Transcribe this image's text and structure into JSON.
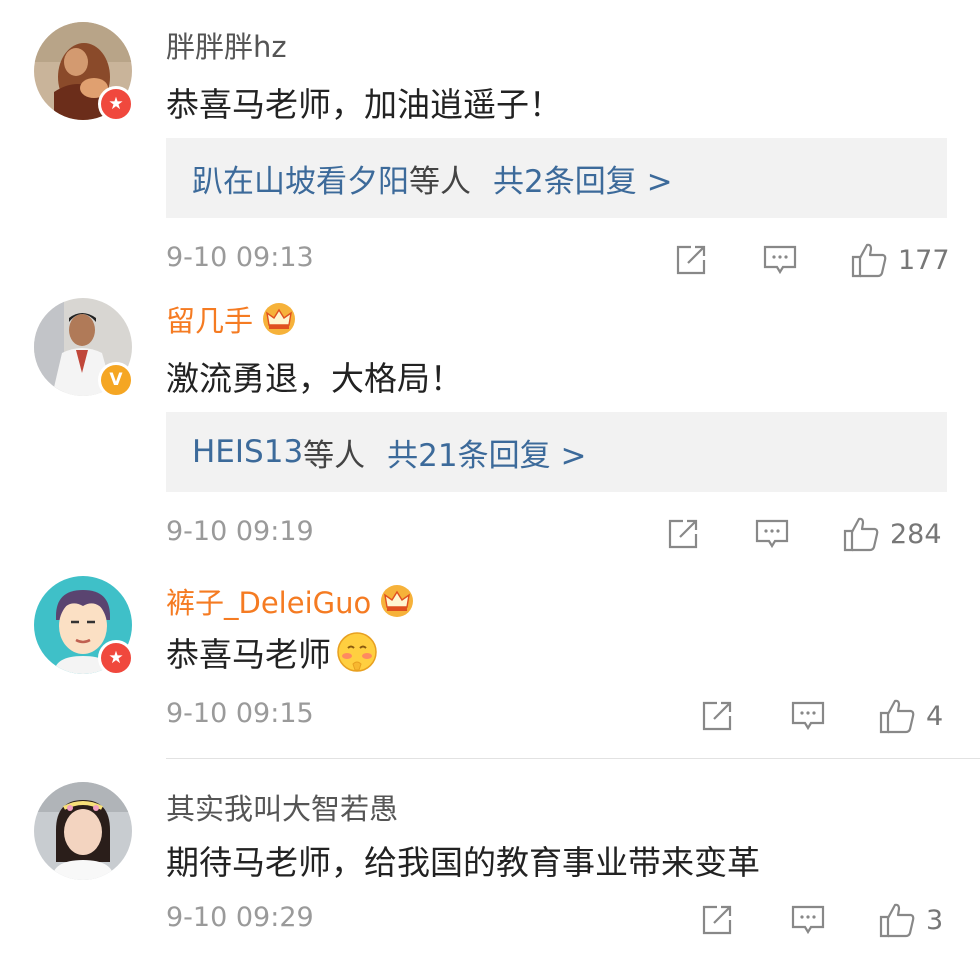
{
  "comments": [
    {
      "username": "胖胖胖hz",
      "vip": false,
      "badge": "red-star",
      "text": "恭喜马老师，加油逍遥子！",
      "replies": {
        "names": "趴在山坡看夕阳",
        "others": "等人",
        "count": "共2条回复 >"
      },
      "time": "9-10 09:13",
      "likes": "177"
    },
    {
      "username": "留几手",
      "vip": true,
      "badge": "verified-v",
      "text": "激流勇退，大格局！",
      "replies": {
        "names": "HEIS13",
        "others": "等人",
        "count": "共21条回复 >"
      },
      "time": "9-10 09:19",
      "likes": "284"
    },
    {
      "username": "裤子_DeleiGuo",
      "vip": true,
      "badge": "red-star",
      "text": "恭喜马老师",
      "emoji": "blush-face",
      "time": "9-10 09:15",
      "likes": "4"
    },
    {
      "username": "其实我叫大智若愚",
      "vip": false,
      "badge": null,
      "text": "期待马老师，给我国的教育事业带来变革",
      "time": "9-10 09:29",
      "likes": "3"
    }
  ],
  "icons": {
    "share": "share-icon",
    "comment": "comment-icon",
    "like": "thumbs-up-icon",
    "crown": "crown-icon"
  },
  "colors": {
    "vip_name": "#f57b22",
    "reply_link": "#3c6a9a",
    "badge_red": "#f0483d",
    "badge_v": "#f5a623"
  }
}
